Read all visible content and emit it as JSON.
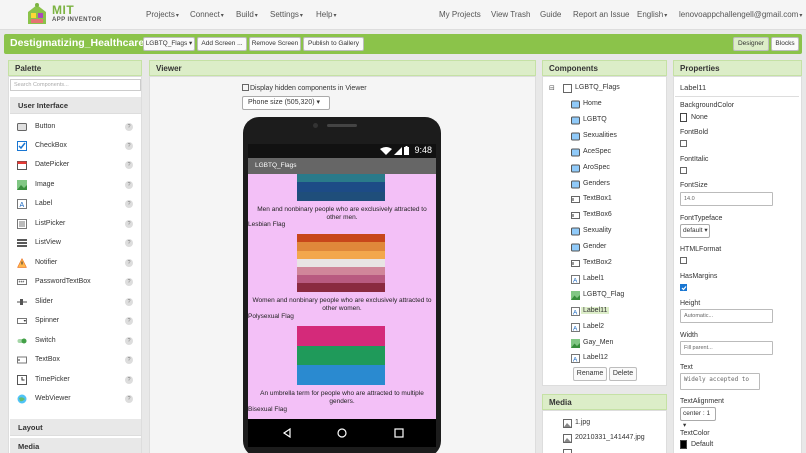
{
  "brand": {
    "title": "MIT",
    "subtitle": "APP INVENTOR"
  },
  "top_menu": [
    "Projects",
    "Connect",
    "Build",
    "Settings",
    "Help"
  ],
  "top_right": {
    "my_projects": "My Projects",
    "view_trash": "View Trash",
    "guide": "Guide",
    "report": "Report an Issue",
    "language": "English",
    "account": "lenovoappchallengell@gmail.com"
  },
  "project": {
    "name": "Destigmatizing_Healthcare",
    "screen_select": "LGBTQ_Flags",
    "add_screen": "Add Screen ...",
    "remove_screen": "Remove Screen",
    "publish": "Publish to Gallery",
    "designer": "Designer",
    "blocks": "Blocks"
  },
  "palette": {
    "title": "Palette",
    "search_placeholder": "Search Components...",
    "section": "User Interface",
    "items": [
      "Button",
      "CheckBox",
      "DatePicker",
      "Image",
      "Label",
      "ListPicker",
      "ListView",
      "Notifier",
      "PasswordTextBox",
      "Slider",
      "Spinner",
      "Switch",
      "TextBox",
      "TimePicker",
      "WebViewer"
    ],
    "layout": "Layout",
    "media": "Media"
  },
  "viewer": {
    "title": "Viewer",
    "hidden_checkbox": "Display hidden components in Viewer",
    "size_select": "Phone size (505,320)",
    "status_time": "9:48",
    "screen_title": "LGBTQ_Flags",
    "desc1": "Men and nonbinary people who are exclusively attracted to other men.",
    "name1": "Lesbian Flag",
    "desc2": "Women and nonbinary people who are exclusively attracted to other women.",
    "name2": "Polysexual Flag",
    "desc3": "An umbrella term for people who are attracted to multiple genders.",
    "name3": "Bisexual Flag"
  },
  "components": {
    "title": "Components",
    "root": "LGBTQ_Flags",
    "items": [
      "Home",
      "LGBTQ",
      "Sexualities",
      "AceSpec",
      "AroSpec",
      "Genders",
      "TextBox1",
      "TextBox6",
      "Sexuality",
      "Gender",
      "TextBox2",
      "Label1",
      "LGBTQ_Flag",
      "Label11",
      "Label2",
      "Gay_Men",
      "Label12"
    ],
    "rename": "Rename",
    "delete": "Delete"
  },
  "media": {
    "title": "Media",
    "items": [
      "1.jpg",
      "20210331_141447.jpg"
    ]
  },
  "properties": {
    "title": "Properties",
    "component": "Label11",
    "background_color_label": "BackgroundColor",
    "background_color_value": "None",
    "font_bold": "FontBold",
    "font_italic": "FontItalic",
    "font_size_label": "FontSize",
    "font_size_value": "14.0",
    "font_typeface_label": "FontTypeface",
    "font_typeface_value": "default",
    "html_format": "HTMLFormat",
    "has_margins": "HasMargins",
    "height_label": "Height",
    "height_value": "Automatic...",
    "width_label": "Width",
    "width_value": "Fill parent...",
    "text_label": "Text",
    "text_value": "Widely accepted to",
    "text_alignment_label": "TextAlignment",
    "text_alignment_value": "center : 1",
    "text_color_label": "TextColor",
    "text_color_value": "Default"
  },
  "colors": {
    "accent_green": "#8bc34a",
    "screen_bg": "#f3c0f7",
    "selected_bg": "#dcedc8"
  }
}
